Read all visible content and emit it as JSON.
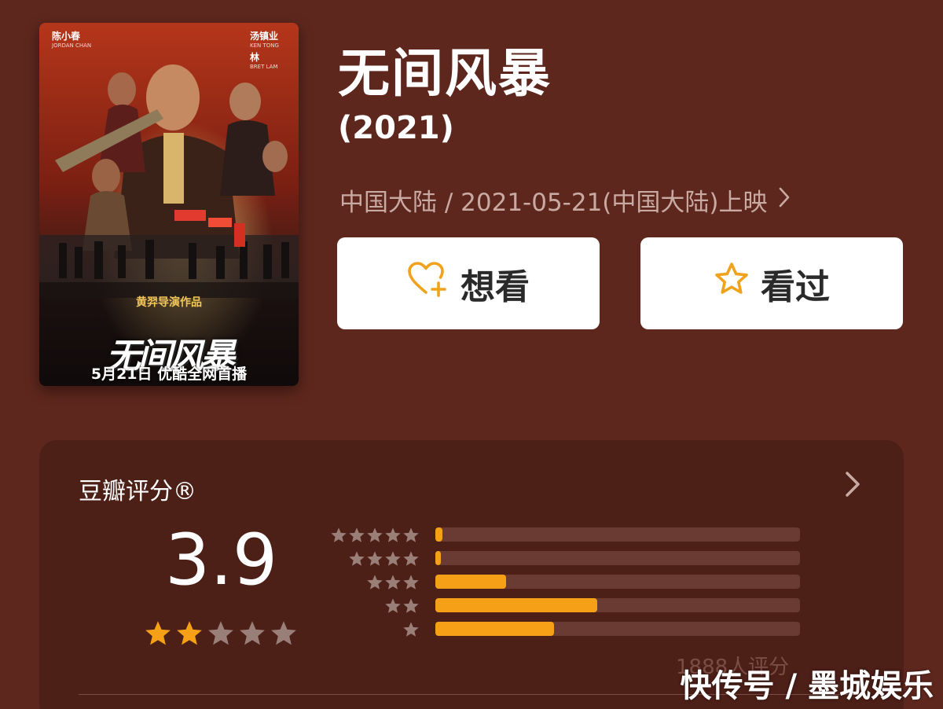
{
  "movie": {
    "title": "无间风暴",
    "year": "(2021)",
    "meta": "中国大陆 / 2021-05-21(中国大陆)上映"
  },
  "poster": {
    "credit_left": "陈小春",
    "credit_left_en": "JORDAN CHAN",
    "credit_right": "汤镇业",
    "credit_right_en": "KEN TONG",
    "credit_right2": "林",
    "credit_right2_en": "BRET LAM",
    "director": "黄羿导演作品",
    "logo_text": "无间风暴",
    "release": "5月21日 优酷全网首播"
  },
  "actions": {
    "want_label": "想看",
    "seen_label": "看过"
  },
  "rating": {
    "title": "豆瓣评分®",
    "score": "3.9",
    "score_stars_filled": 2,
    "distribution": [
      {
        "stars": 5,
        "percent": 2
      },
      {
        "stars": 4,
        "percent": 1.5
      },
      {
        "stars": 3,
        "percent": 19.5
      },
      {
        "stars": 2,
        "percent": 44.5
      },
      {
        "stars": 1,
        "percent": 32.5
      }
    ],
    "count_text": "1888人评分"
  },
  "watermark": "快传号 / 墨城娱乐",
  "colors": {
    "background": "#5e271d",
    "card": "#4c1f17",
    "accent": "#f6a018",
    "star_empty": "#9a7f79"
  }
}
